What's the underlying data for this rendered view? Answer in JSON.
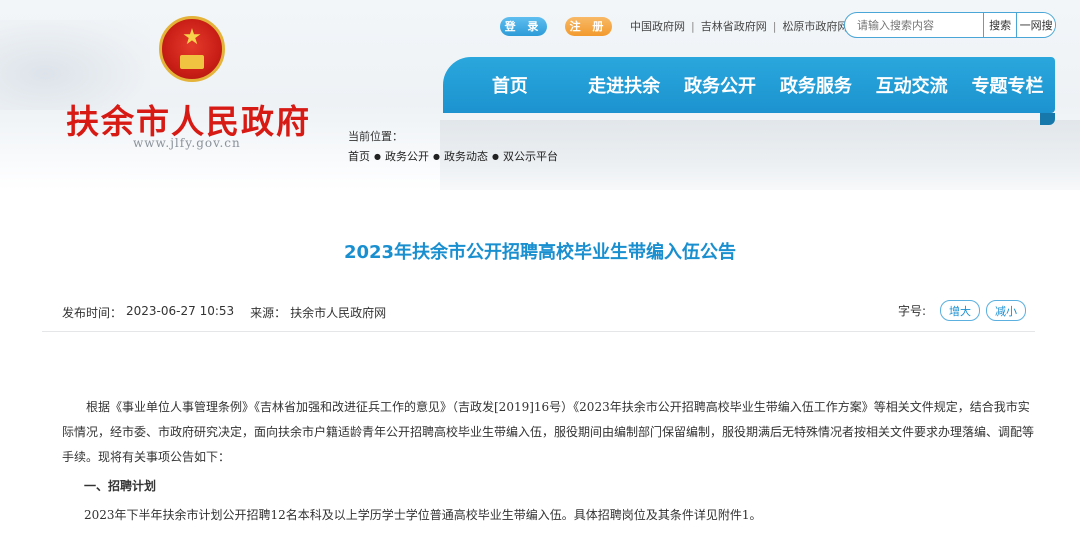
{
  "header": {
    "site_title": "扶余市人民政府",
    "site_url": "www.jlfy.gov.cn",
    "login_label": "登 录",
    "register_label": "注 册",
    "links": [
      "中国政府网",
      "吉林省政府网",
      "松原市政府网"
    ],
    "search": {
      "placeholder": "请输入搜索内容",
      "button_label": "搜索",
      "button2_label": "一网搜"
    }
  },
  "nav": {
    "items": [
      "首页",
      "走进扶余",
      "政务公开",
      "政务服务",
      "互动交流",
      "专题专栏"
    ]
  },
  "breadcrumb": {
    "label": "当前位置：",
    "items": [
      "首页",
      "政务公开",
      "政务动态",
      "双公示平台"
    ]
  },
  "article": {
    "title": "2023年扶余市公开招聘高校毕业生带编入伍公告",
    "publish_label": "发布时间：",
    "publish_time": "2023-06-27 10:53",
    "source_label": "来源：",
    "source": "扶余市人民政府网",
    "font_size_label": "字号:",
    "increase_label": "增大",
    "decrease_label": "减小",
    "paragraph1": "根据《事业单位人事管理条例》《吉林省加强和改进征兵工作的意见》（吉政发[2019]16号）《2023年扶余市公开招聘高校毕业生带编入伍工作方案》等相关文件规定，结合我市实际情况，经市委、市政府研究决定，面向扶余市户籍适龄青年公开招聘高校毕业生带编入伍，服役期间由编制部门保留编制，服役期满后无特殊情况者按相关文件要求办理落编、调配等手续。现将有关事项公告如下：",
    "heading1": "一、招聘计划",
    "paragraph2": "2023年下半年扶余市计划公开招聘12名本科及以上学历学士学位普通高校毕业生带编入伍。具体招聘岗位及其条件详见附件1。"
  },
  "colors": {
    "nav_blue": "#1c93cf",
    "title_blue": "#1a8fd0",
    "brand_red": "#d71a14"
  }
}
